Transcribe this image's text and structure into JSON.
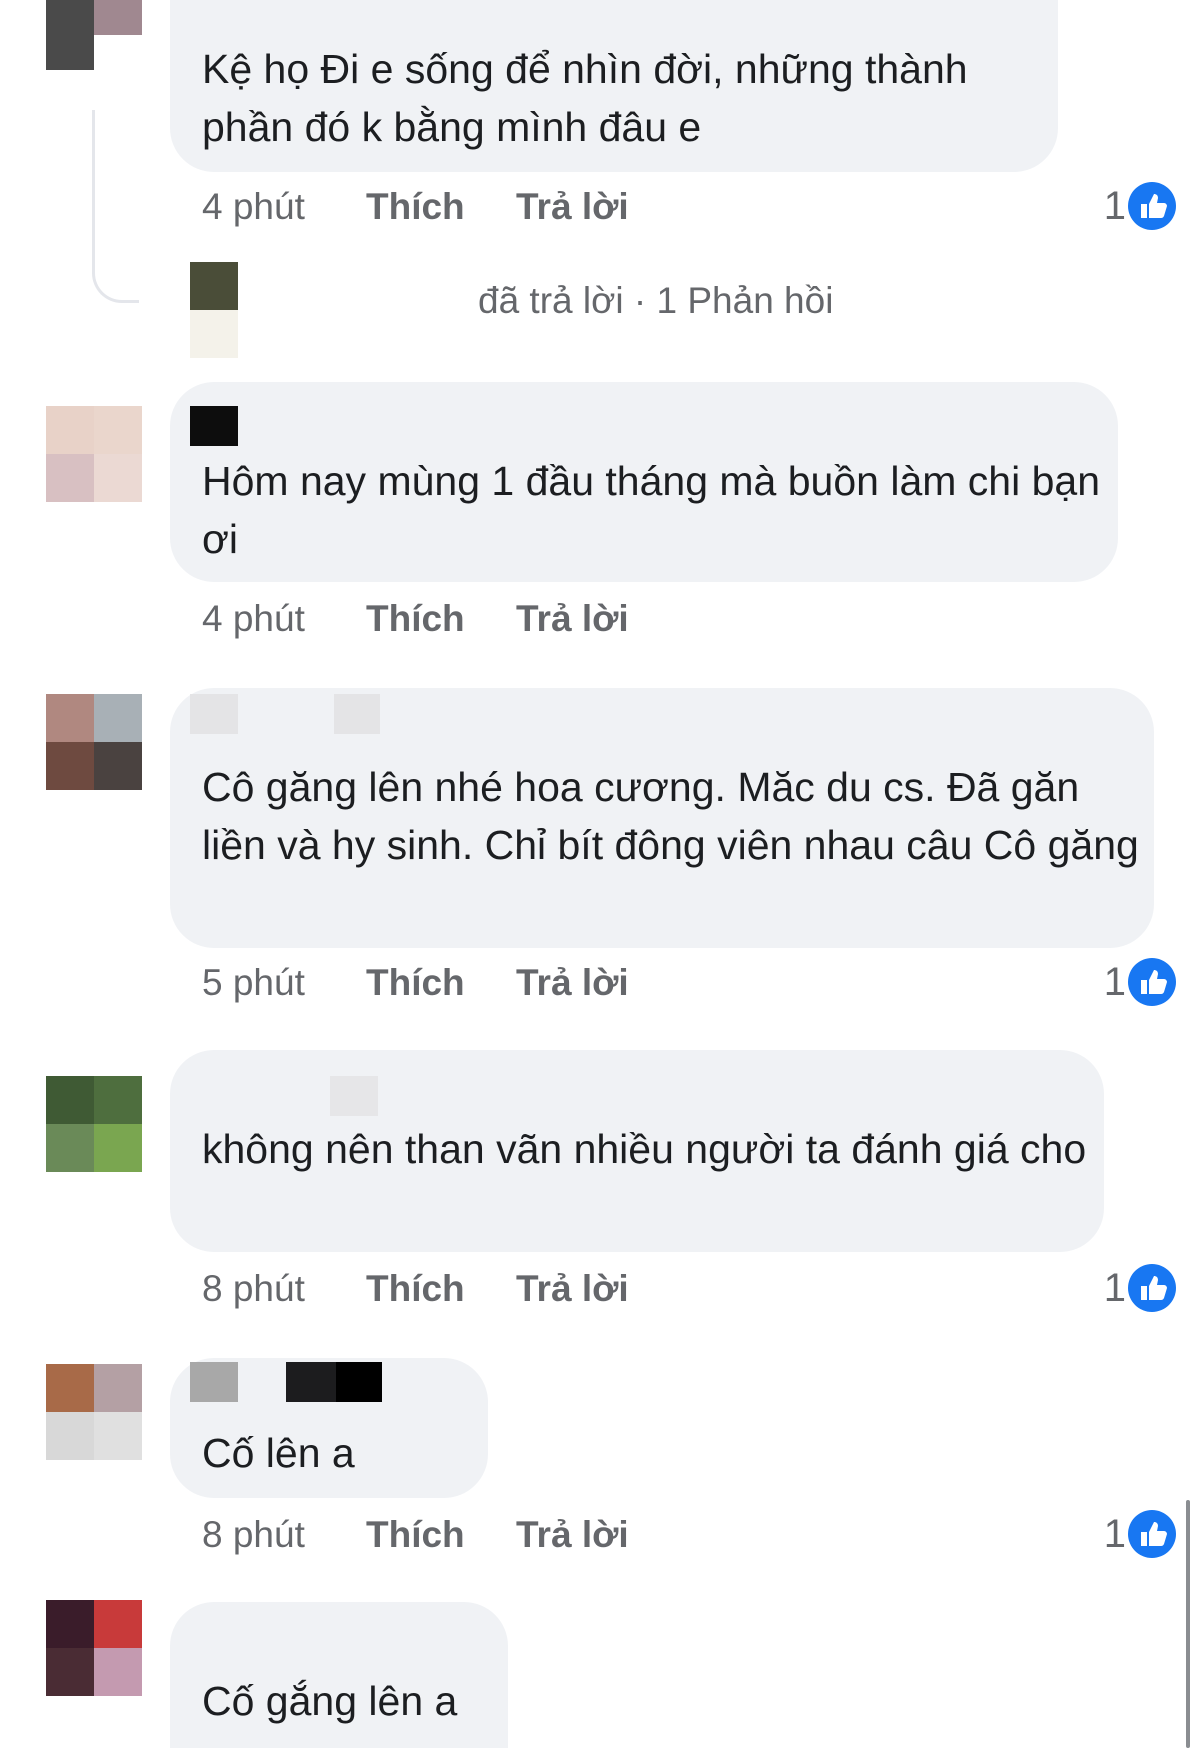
{
  "colors": {
    "bubble": "#f0f2f5",
    "text": "#1c1e21",
    "meta": "#65676b",
    "like_badge": "#1877f2"
  },
  "comments": [
    {
      "text": "Kệ họ Đi e sống để nhìn đời, những thành phần đó k bằng mình đâu e",
      "time": "4 phút",
      "like": "Thích",
      "reply": "Trả lời",
      "reaction_count": "1",
      "reaction_icon": "like-icon"
    },
    {
      "text": "Hôm nay mùng 1 đầu tháng mà buồn làm chi bạn ơi",
      "time": "4 phút",
      "like": "Thích",
      "reply": "Trả lời"
    },
    {
      "text": "Cô găng lên nhé hoa cương. Măc du cs. Đã găn liền và hy sinh. Chỉ bít đông viên nhau câu Cô găng",
      "time": "5 phút",
      "like": "Thích",
      "reply": "Trả lời",
      "reaction_count": "1",
      "reaction_icon": "like-icon"
    },
    {
      "text": "không nên than vãn nhiều người ta đánh giá cho",
      "time": "8 phút",
      "like": "Thích",
      "reply": "Trả lời",
      "reaction_count": "1",
      "reaction_icon": "like-icon"
    },
    {
      "text": "Cố lên a",
      "time": "8 phút",
      "like": "Thích",
      "reply": "Trả lời",
      "reaction_count": "1",
      "reaction_icon": "like-icon"
    },
    {
      "text": "Cố gắng lên a"
    }
  ],
  "reply_thread": {
    "label": "đã trả lời",
    "separator": "·",
    "count_label": "1 Phản hồi"
  }
}
